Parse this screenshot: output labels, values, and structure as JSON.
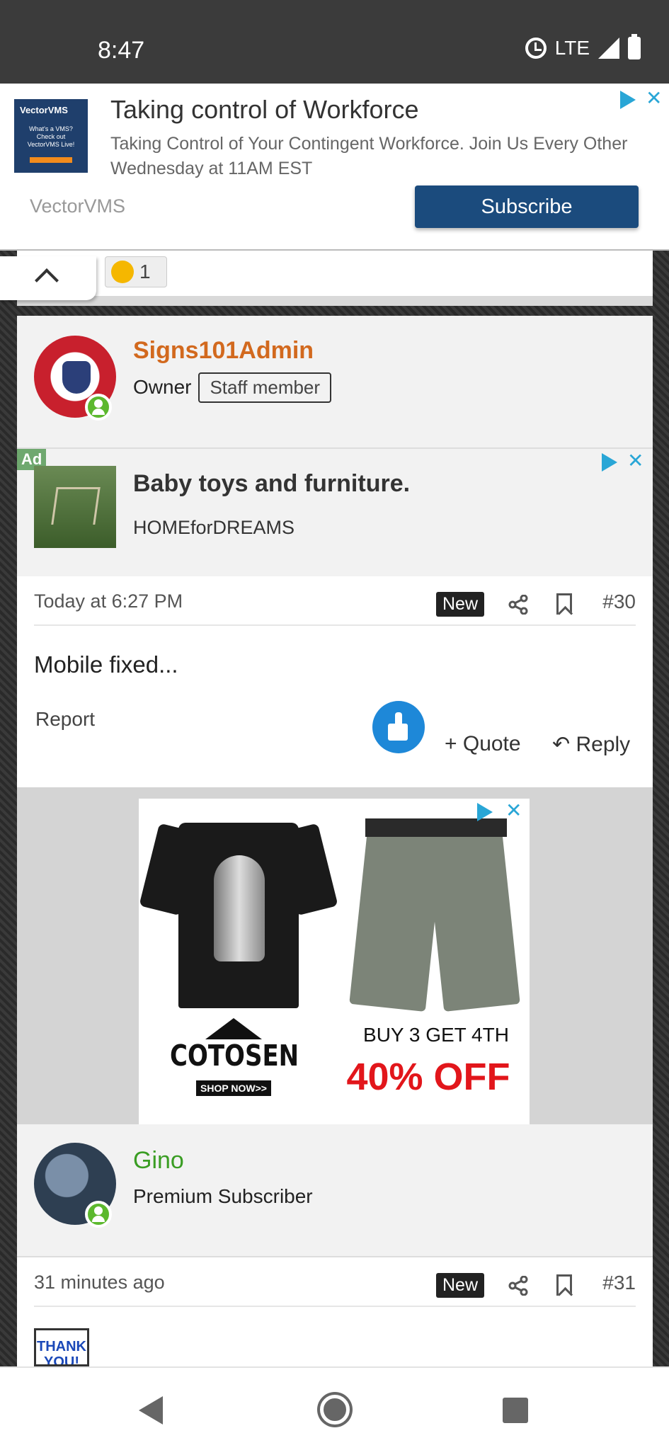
{
  "status_bar": {
    "time": "8:47",
    "network": "LTE"
  },
  "top_ad": {
    "logo_text": "VectorVMS",
    "logo_sub": "What's a VMS? Check out VectorVMS Live!",
    "title": "Taking control of Workforce",
    "description": "Taking Control of Your Contingent Workforce. Join Us Every Other Wednesday at 11AM EST",
    "advertiser": "VectorVMS",
    "cta": "Subscribe"
  },
  "reaction": {
    "count": "1"
  },
  "post30": {
    "author": "Signs101Admin",
    "author_color": "#d2691e",
    "role": "Owner",
    "badge": "Staff member",
    "date": "Today at 6:27 PM",
    "new_label": "New",
    "number": "#30",
    "body": "Mobile fixed...",
    "report": "Report",
    "quote": "+ Quote",
    "reply": "Reply"
  },
  "inline_ad": {
    "tag": "Ad",
    "title": "Baby toys and furniture.",
    "advertiser": "HOMEforDREAMS"
  },
  "shop_ad": {
    "brand": "COTOSEN",
    "shop_now": "SHOP NOW>>",
    "promo_line1": "BUY 3 GET 4TH",
    "promo_line2": "40% OFF"
  },
  "post31": {
    "author": "Gino",
    "author_color": "#3a9d23",
    "role": "Premium Subscriber",
    "date": "31 minutes ago",
    "new_label": "New",
    "number": "#31",
    "image_text": "THANK YOU!"
  }
}
